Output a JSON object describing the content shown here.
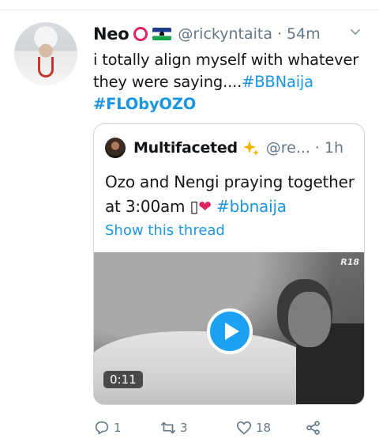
{
  "tweet": {
    "author_name": "Neo",
    "handle": "@rickyntaita",
    "separator": "·",
    "time": "54m",
    "text_plain": "i totally align myself with whatever they were saying....",
    "hashtag_1": "#BBNaija",
    "hashtag_2": "#FLObyOZO"
  },
  "quoted_tweet": {
    "author_name": "Multifaceted",
    "handle": "@re...",
    "time": "· 1h",
    "text_line1": "Ozo and Nengi praying together",
    "text_line2_prefix": "at 3:00am ",
    "missing_glyph": "▯",
    "heart": "❤",
    "hashtag": "#bbnaija",
    "show_thread_label": "Show this thread",
    "video": {
      "badge": "R18",
      "duration": "0:11"
    }
  },
  "actions": {
    "reply_count": "1",
    "retweet_count": "3",
    "like_count": "18"
  },
  "icons": {
    "status": "red-ring-icon",
    "flag": "lesotho-flag-icon",
    "verified_like": "sparkle-icon",
    "menu": "chevron-down-icon",
    "play": "play-icon",
    "reply": "reply-icon",
    "retweet": "retweet-icon",
    "like": "heart-icon",
    "share": "share-icon"
  },
  "colors": {
    "link": "#1b95e0",
    "secondary_text": "#657786",
    "play_button": "#1da1f2",
    "status_ring": "#e0245e"
  }
}
